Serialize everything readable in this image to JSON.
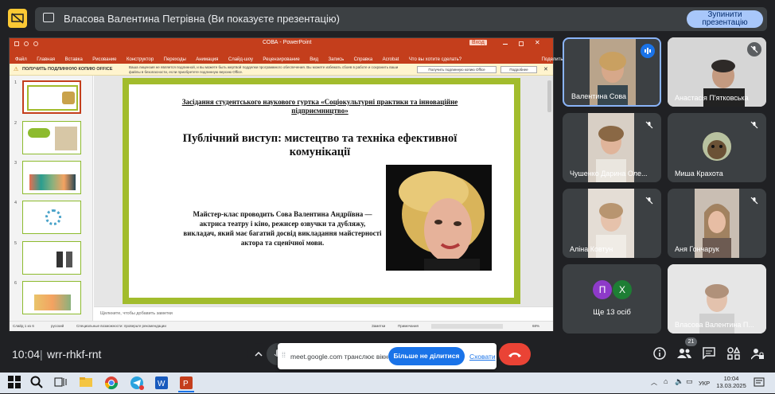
{
  "banner": {
    "text": "Власова Валентина Петрівна (Ви показуєте презентацію)",
    "stop_label": "Зупинити презентацію"
  },
  "powerpoint": {
    "title": "СОВА  -  PowerPoint",
    "login_label": "Вход",
    "menu": [
      "Файл",
      "Главная",
      "Вставка",
      "Рисование",
      "Конструктор",
      "Переходы",
      "Анимация",
      "Слайд-шоу",
      "Рецензирование",
      "Вид",
      "Запись",
      "Справка",
      "Acrobat",
      "Что вы хотите сделать?",
      "Поделиться"
    ],
    "warning_title": "ПОЛУЧИТЬ ПОДЛИННУЮ КОПИЮ OFFICE",
    "warning_body": "Ваша лицензия не является подлинной, и вы можете быть жертвой подделки программного обеспечения. Вы можете избежать сбоев в работе и сохранить ваши файлы в безопасности, если приобретете подлинную версию Office.",
    "warning_btn1": "Получить подлинную копию Office",
    "warning_btn2": "Подробнее",
    "thumb_numbers": [
      "1",
      "2",
      "3",
      "4",
      "5",
      "6"
    ],
    "slide": {
      "heading": "Засідання студентського наукового гуртка «Соціокультурні практики та інноваційне підприємництво»",
      "title": "Публічний виступ: мистецтво та техніка ефективної комунікації",
      "body": "Майстер-клас проводить Сова Валентина Андріївна — актриса театру і кіно, режисер озвучки та дубляжу, викладач, який має багатий досвід викладання майстерності актора та сценічної мови."
    },
    "notes_placeholder": "Щелкните, чтобы добавить заметки",
    "status": {
      "slide": "Слайд 1 из 6",
      "lang": "русский",
      "accessibility": "Специальные возможности: проверьте рекомендации",
      "notes": "Заметки",
      "comments": "Примечания",
      "zoom": "68%"
    }
  },
  "participants": [
    {
      "name": "Валентина Сова",
      "state": "speaking"
    },
    {
      "name": "Анастасія П'ятковська",
      "state": "muted"
    },
    {
      "name": "Чушенко Дарина Оле...",
      "state": "muted"
    },
    {
      "name": "Миша Крахота",
      "state": "muted"
    },
    {
      "name": "Аліна Ковтун",
      "state": "muted"
    },
    {
      "name": "Аня Гончарук",
      "state": "muted"
    },
    {
      "name": "Ще 13 осіб",
      "state": "others",
      "avatars": [
        "П",
        "Х"
      ]
    },
    {
      "name": "Власова Валентина П...",
      "state": "muted"
    }
  ],
  "meeting": {
    "time": "10:04",
    "separator": "|",
    "code": "wrr-rhkf-rnt",
    "people_count": "21"
  },
  "toast": {
    "text": "meet.google.com транслює вікно.",
    "stop_label": "Більше не ділитися",
    "hide_label": "Сховати"
  },
  "taskbar": {
    "lang": "УКР",
    "clock_time": "10:04",
    "clock_date": "13.03.2025"
  },
  "colors": {
    "accent": "#8ab4f8",
    "ppt_red": "#c43e1c",
    "slide_border": "#a2bc2d",
    "end_call": "#ea4335",
    "button_blue": "#1a73e8"
  }
}
